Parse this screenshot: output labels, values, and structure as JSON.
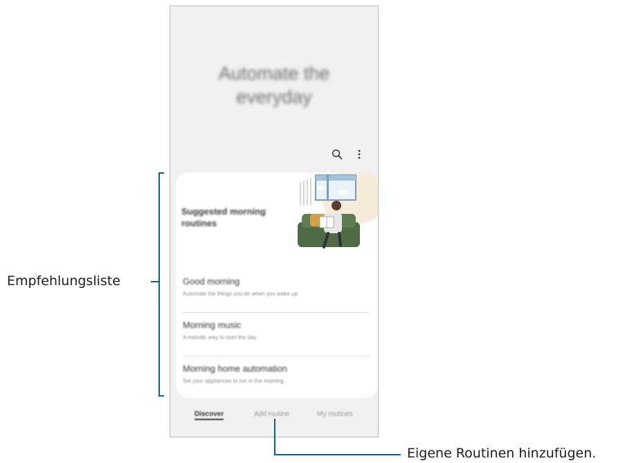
{
  "screen": {
    "hero_title_line1": "Automate the",
    "hero_title_line2": "everyday",
    "icons": [
      "search-icon",
      "more-vert-icon"
    ],
    "card": {
      "title_line1": "Suggested morning",
      "title_line2": "routines",
      "items": [
        {
          "title": "Good morning",
          "subtitle": "Automate the things you do when you wake up."
        },
        {
          "title": "Morning music",
          "subtitle": "A melodic way to start the day."
        },
        {
          "title": "Morning home automation",
          "subtitle": "Set your appliances to run in the morning."
        }
      ]
    },
    "tabs": [
      {
        "label": "Discover",
        "active": true
      },
      {
        "label": "Add routine",
        "active": false
      },
      {
        "label": "My routines",
        "active": false
      }
    ]
  },
  "annotations": {
    "recommendations_label": "Empfehlungsliste",
    "add_routine_label": "Eigene Routinen hinzufügen."
  },
  "colors": {
    "annotation_line": "#0a5f8f",
    "screen_bg": "#f1f1f1",
    "card_bg": "#ffffff",
    "illustration_blob": "#f6ecd9",
    "sofa": "#4f6b45"
  }
}
